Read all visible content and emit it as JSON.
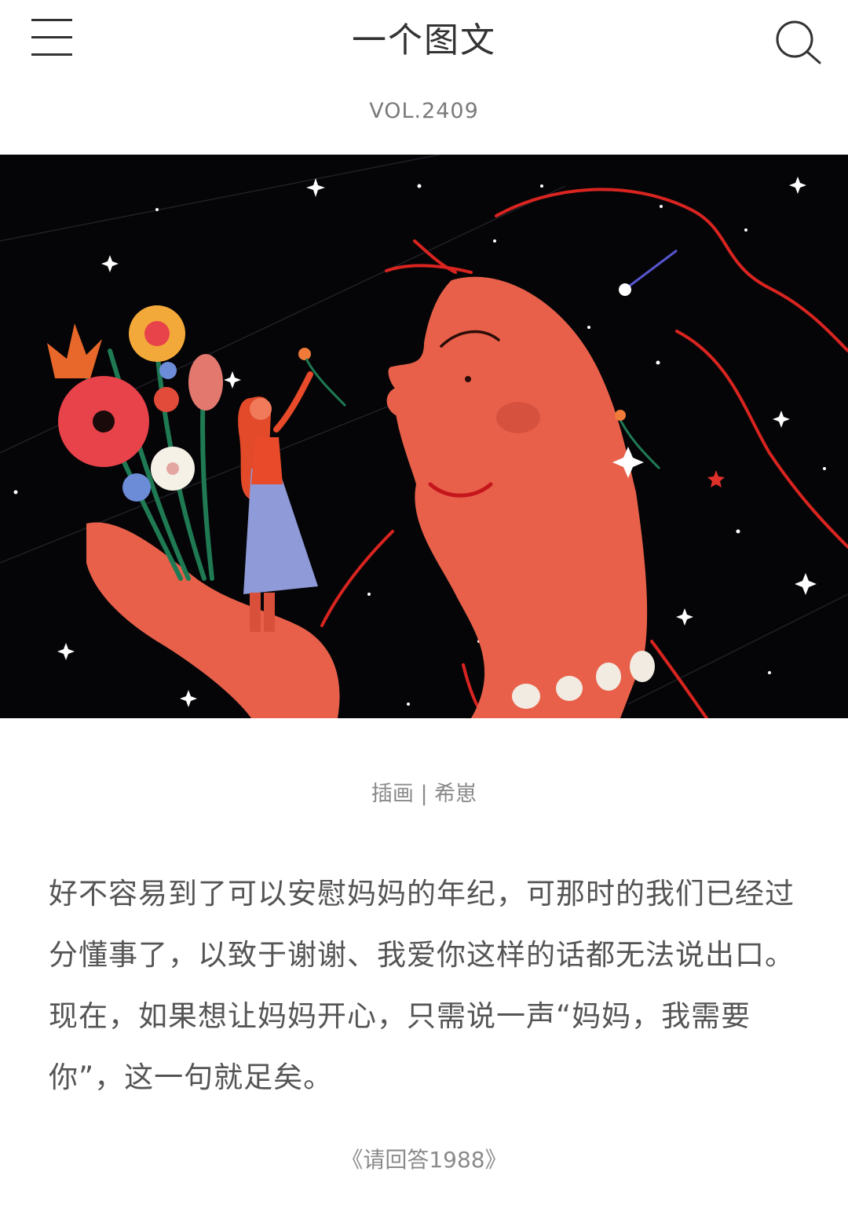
{
  "header": {
    "title": "一个图文",
    "menu_icon": "hamburger-menu-icon",
    "search_icon": "search-icon"
  },
  "article": {
    "volume": "VOL.2409",
    "illustration_credit": "插画 | 希崽",
    "text": "好不容易到了可以安慰妈妈的年纪，可那时的我们已经过分懂事了，以致于谢谢、我爱你这样的话都无法说出口。现在，如果想让妈妈开心，只需说一声“妈妈，我需要你”，这一句就足矣。",
    "source": "《请回答1988》"
  },
  "colors": {
    "text_primary": "#333333",
    "text_secondary": "#8a8a8a",
    "illustration_bg": "#050507",
    "illustration_accent": "#e8604a"
  }
}
